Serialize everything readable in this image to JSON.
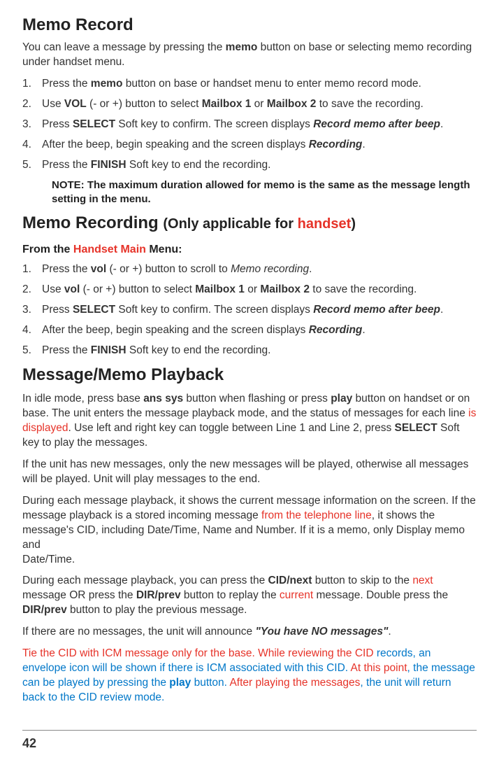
{
  "memoRecord": {
    "title": "Memo Record",
    "intro_1": "You can leave a message by pressing the ",
    "intro_memo": "memo",
    "intro_2": " button on base or selecting memo recording under handset menu.",
    "steps": {
      "s1a": "Press the ",
      "s1b": "memo",
      "s1c": " button on base or handset menu to enter memo record mode.",
      "s2a": "Use ",
      "s2b": "VOL",
      "s2c": " (- or +) button to select ",
      "s2d": "Mailbox 1",
      "s2e": " or ",
      "s2f": "Mailbox 2",
      "s2g": " to save the recording.",
      "s3a": "Press ",
      "s3b": "SELECT",
      "s3c": " Soft key to confirm. The screen displays ",
      "s3d": "Record memo after beep",
      "s3e": ".",
      "s4a": "After the beep, begin speaking and the screen displays ",
      "s4b": "Recording",
      "s4c": ".",
      "s5a": "Press the ",
      "s5b": "FINISH",
      "s5c": " Soft key to end the recording."
    },
    "note": "NOTE: The maximum duration allowed for memo is the same as the message length setting in the menu."
  },
  "memoRecording": {
    "title_1": "Memo Recording ",
    "title_2a": "(Only applicable for ",
    "title_2b": "handset",
    "title_2c": ")",
    "fromMenu_1": "From the ",
    "fromMenu_2": "Handset Main",
    "fromMenu_3": " Menu:",
    "steps": {
      "s1a": "Press the ",
      "s1b": "vol",
      "s1c": " (- or +) button to scroll to ",
      "s1d": "Memo recording",
      "s1e": ".",
      "s2a": "Use ",
      "s2b": "vol",
      "s2c": " (- or +) button to select ",
      "s2d": "Mailbox 1",
      "s2e": " or ",
      "s2f": "Mailbox 2",
      "s2g": " to save the recording.",
      "s3a": "Press ",
      "s3b": "SELECT",
      "s3c": " Soft key to confirm. The screen displays ",
      "s3d": "Record memo after beep",
      "s3e": ".",
      "s4a": "After the beep, begin speaking and the screen displays ",
      "s4b": "Recording",
      "s4c": ".",
      "s5a": "Press the ",
      "s5b": "FINISH",
      "s5c": " Soft key to end the recording."
    }
  },
  "playback": {
    "title": "Message/Memo Playback",
    "p1a": "In idle mode, press base ",
    "p1b": "ans sys",
    "p1c": " button when flashing or press ",
    "p1d": "play",
    "p1e": " button on handset or on base. The unit enters the message playback mode, and the status of messages for each line ",
    "p1f": "is displayed",
    "p1g": ". Use left and right key can toggle between Line 1 and Line 2, press ",
    "p1h": "SELECT",
    "p1i": " Soft key to play the messages.",
    "p2": "If the unit has new messages, only the new messages will be played, otherwise all messages will be played. Unit will play messages to the end.",
    "p3a": "During each message playback, it shows the current message information on the screen. If the message playback is a stored incoming message ",
    "p3b": "from the telephone line",
    "p3c": ", it shows the message's CID, including Date/Time, Name and Number. If it is a memo, only Display memo and",
    "p3d": "Date/Time.",
    "p4a": "During each message playback, you can press the ",
    "p4b": "CID/next",
    "p4c": " button to skip to the ",
    "p4d": "next",
    "p4e": " message OR press the ",
    "p4f": "DIR/prev",
    "p4g": " button to replay the ",
    "p4h": "current",
    "p4i": " message. Double press the ",
    "p4j": "DIR/prev",
    "p4k": " button to play the previous message.",
    "p5a": "If there are no messages, the unit will announce ",
    "p5b": "\"You have NO messages\"",
    "p5c": ".",
    "p6a": "Tie the CID with ICM message only for the base. While reviewing the CID ",
    "p6b": "records, an envelope icon will be shown if there is ICM associated with this CID.  ",
    "p6c": "At this point",
    "p6d": ", the message can be played by pressing the ",
    "p6e": "play",
    "p6f": " button.  ",
    "p6g": "After playing the messages",
    "p6h": ", the unit will return back to the CID review mode."
  },
  "pageNumber": "42"
}
